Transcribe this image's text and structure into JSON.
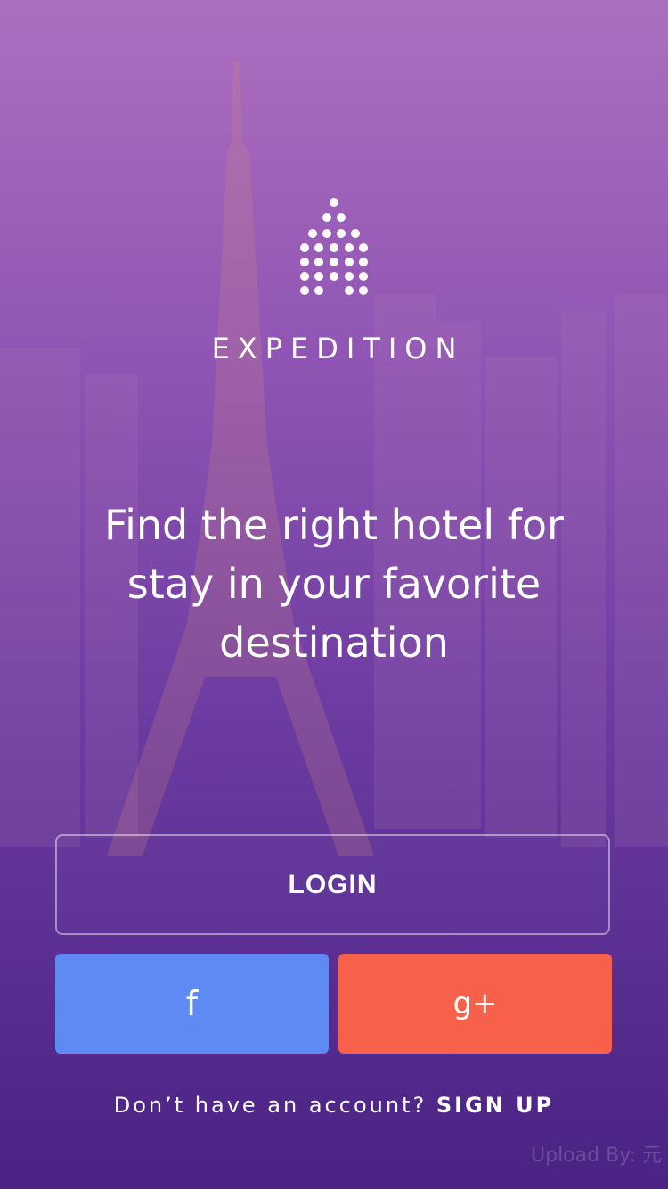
{
  "brand": {
    "name": "EXPEDITION",
    "logo_icon": "hotel-dots-icon"
  },
  "tagline": "Find the right hotel for stay in your favorite destination",
  "login": {
    "label": "LOGIN"
  },
  "social": {
    "facebook": {
      "label": "f",
      "icon": "facebook-icon",
      "color": "#5f89f3"
    },
    "google": {
      "label": "g+",
      "icon": "google-plus-icon",
      "color": "#f7604b"
    }
  },
  "footer": {
    "prompt": "Don’t have an account? ",
    "signup_label": "SIGN UP"
  },
  "watermark": "Upload By: 元",
  "colors": {
    "gradient_top": "#ac6fbf",
    "gradient_bottom": "#4a2384"
  }
}
